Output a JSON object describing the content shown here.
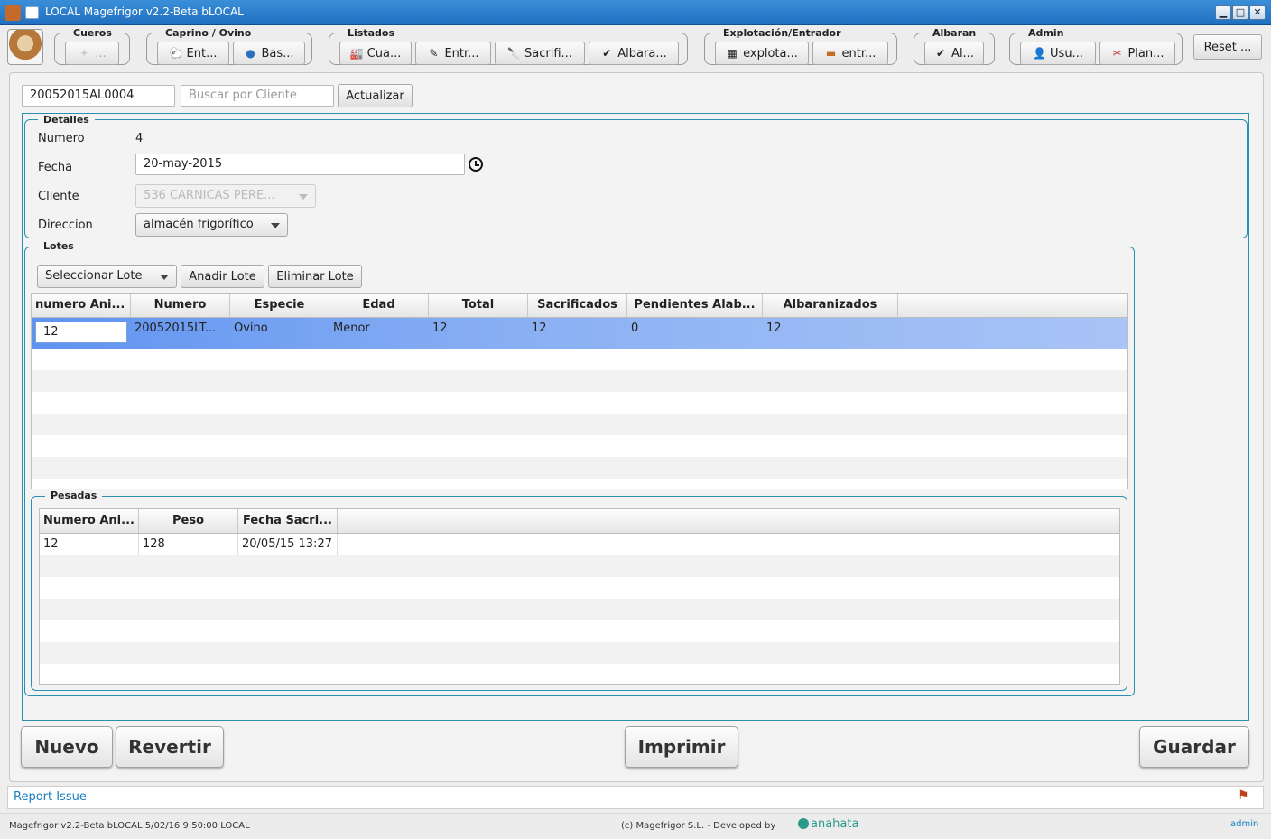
{
  "window": {
    "title": "LOCAL Magefrigor v2.2-Beta bLOCAL",
    "minimize": "▁",
    "maximize": "□",
    "close": "✕"
  },
  "toolbar": {
    "groups": [
      {
        "title": "Cueros"
      },
      {
        "title": "Caprino / Ovino"
      },
      {
        "title": "Listados"
      },
      {
        "title": "Explotación/Entrador"
      },
      {
        "title": "Albaran"
      },
      {
        "title": "Admin"
      }
    ],
    "buttons": {
      "cueros": "...",
      "ent": "Ent...",
      "bas": "Bas...",
      "cua": "Cua...",
      "entr": "Entr...",
      "sacrifi": "Sacrifi...",
      "albara": "Albara...",
      "explota": "explota...",
      "entr2": "entr...",
      "al": "Al...",
      "usu": "Usu...",
      "plan": "Plan..."
    },
    "reset": "Reset ..."
  },
  "search": {
    "albaran_value": "20052015AL0004",
    "cliente_placeholder": "Buscar por Cliente",
    "refresh": "Actualizar"
  },
  "detalles": {
    "legend": "Detalles",
    "numero_label": "Numero",
    "numero_value": "4",
    "fecha_label": "Fecha",
    "fecha_value": "20-may-2015",
    "cliente_label": "Cliente",
    "cliente_value": "536 CARNICAS PERE...",
    "direccion_label": "Direccion",
    "direccion_value": "almacén frigorífico"
  },
  "lotes": {
    "legend": "Lotes",
    "select_lote": "Seleccionar Lote",
    "add_lote": "Anadir Lote",
    "remove_lote": "Eliminar Lote",
    "columns": [
      "numero Ani...",
      "Numero",
      "Especie",
      "Edad",
      "Total",
      "Sacrificados",
      "Pendientes Alab...",
      "Albaranizados"
    ],
    "rows": [
      {
        "numero_animal": "12",
        "numero": "20052015LT...",
        "especie": "Ovino",
        "edad": "Menor",
        "total": "12",
        "sacrificados": "12",
        "pendientes": "0",
        "albaranizados": "12"
      }
    ]
  },
  "pesadas": {
    "legend": "Pesadas",
    "columns": [
      "Numero Ani...",
      "Peso",
      "Fecha Sacri..."
    ],
    "rows": [
      {
        "numero_animal": "12",
        "peso": "128",
        "fecha": "20/05/15 13:27"
      }
    ]
  },
  "actions": {
    "nuevo": "Nuevo",
    "revertir": "Revertir",
    "imprimir": "Imprimir",
    "guardar": "Guardar"
  },
  "report": {
    "link": "Report Issue"
  },
  "status": {
    "version": "Magefrigor v2.2-Beta bLOCAL 5/02/16 9:50:00 LOCAL",
    "copyright": "(c)  Magefrigor S.L.   - Developed by",
    "developer": "anahata",
    "user": "admin"
  },
  "colors": {
    "accent_border": "#2a8fb0",
    "selection": "#7fa8f0",
    "link": "#1a7fc0",
    "titlebar": "#2a7fd0"
  }
}
